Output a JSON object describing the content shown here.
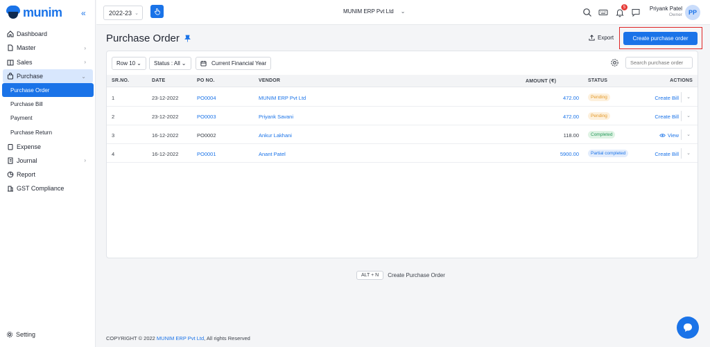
{
  "brand": {
    "logo_text": "munim",
    "accent": "#1a73e8"
  },
  "sidebar": {
    "items": [
      {
        "label": "Dashboard",
        "icon": "home-icon"
      },
      {
        "label": "Master",
        "icon": "file-icon"
      },
      {
        "label": "Sales",
        "icon": "book-icon"
      },
      {
        "label": "Purchase",
        "icon": "bag-icon"
      },
      {
        "label": "Expense",
        "icon": "clipboard-icon"
      },
      {
        "label": "Journal",
        "icon": "journal-icon"
      },
      {
        "label": "Report",
        "icon": "chart-pie-icon"
      },
      {
        "label": "GST Compliance",
        "icon": "building-icon"
      }
    ],
    "purchase_sub": [
      {
        "label": "Purchase Order"
      },
      {
        "label": "Purchase Bill"
      },
      {
        "label": "Payment"
      },
      {
        "label": "Purchase Return"
      }
    ],
    "setting_label": "Setting"
  },
  "topbar": {
    "year": "2022-23",
    "company": "MUNIM ERP Pvt Ltd",
    "notification_count": "5",
    "user_name": "Priyank Patel",
    "user_role": "Owner",
    "avatar_initials": "PP"
  },
  "page": {
    "title": "Purchase Order",
    "export_label": "Export",
    "create_label": "Create purchase order"
  },
  "filters": {
    "rows": "Row 10",
    "status": "Status : All",
    "period": "Current Financial Year",
    "search_placeholder": "Search purchase order"
  },
  "table": {
    "headers": {
      "srno": "SR.NO.",
      "date": "DATE",
      "po": "PO NO.",
      "vendor": "VENDOR",
      "amount": "AMOUNT (₹)",
      "status": "STATUS",
      "actions": "ACTIONS"
    },
    "rows": [
      {
        "srno": "1",
        "date": "23-12-2022",
        "po": "PO0004",
        "vendor": "MUNIM ERP Pvt Ltd",
        "amount": "472.00",
        "status": "Pending",
        "action": "Create Bill"
      },
      {
        "srno": "2",
        "date": "23-12-2022",
        "po": "PO0003",
        "vendor": "Priyank Savani",
        "amount": "472.00",
        "status": "Pending",
        "action": "Create Bill"
      },
      {
        "srno": "3",
        "date": "16-12-2022",
        "po": "PO0002",
        "vendor": "Ankur Lakhani",
        "amount": "118.00",
        "status": "Completed",
        "action": "View"
      },
      {
        "srno": "4",
        "date": "16-12-2022",
        "po": "PO0001",
        "vendor": "Anant Patel",
        "amount": "5900.00",
        "status": "Partial completed",
        "action": "Create Bill"
      }
    ]
  },
  "shortcut": {
    "keys": "ALT + N",
    "label": "Create Purchase Order"
  },
  "footer": {
    "prefix": "COPYRIGHT © 2022 ",
    "company": "MUNIM ERP Pvt Ltd",
    "suffix": ", All rights Reserved"
  }
}
